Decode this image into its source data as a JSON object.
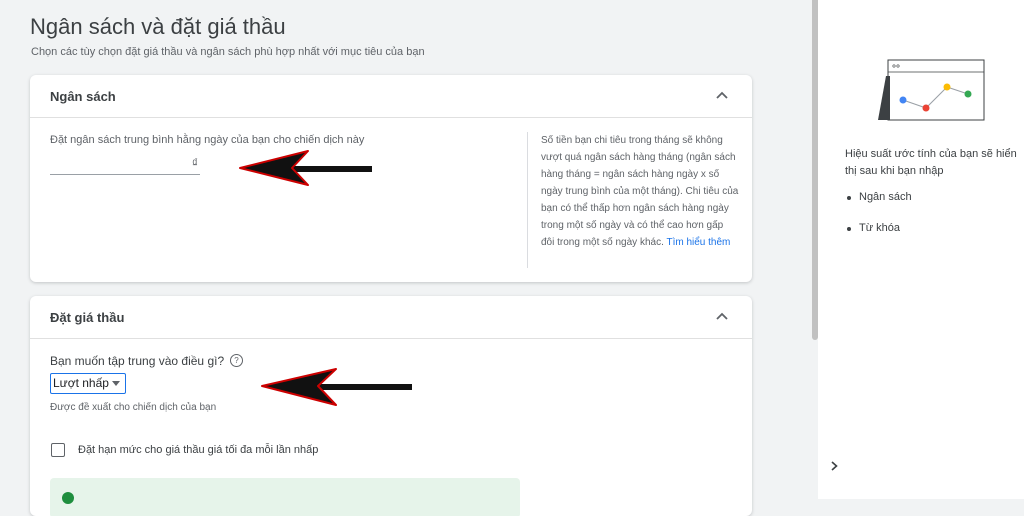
{
  "header": {
    "title": "Ngân sách và đặt giá thầu",
    "subtitle": "Chọn các tùy chọn đặt giá thầu và ngân sách phù hợp nhất với mục tiêu của bạn"
  },
  "budget": {
    "title": "Ngân sách",
    "label": "Đặt ngân sách trung bình hằng ngày của bạn cho chiến dịch này",
    "currency": "₫",
    "help_text": "Số tiền bạn chi tiêu trong tháng sẽ không vượt quá ngân sách hàng tháng (ngân sách hàng tháng = ngân sách hàng ngày x số ngày trung bình của một tháng). Chi tiêu của bạn có thể thấp hơn ngân sách hàng ngày trong một số ngày và có thể cao hơn gấp đôi trong một số ngày khác.",
    "help_link": "Tìm hiểu thêm"
  },
  "bidding": {
    "title": "Đặt giá thầu",
    "question": "Bạn muốn tập trung vào điều gì?",
    "help_glyph": "?",
    "select_value": "Lượt nhấp",
    "note": "Được đề xuất cho chiến dịch của bạn",
    "checkbox_label": "Đặt hạn mức cho giá thầu giá tối đa mỗi lần nhấp"
  },
  "sidebar": {
    "text": "Hiệu suất ước tính của bạn sẽ hiển thị sau khi bạn nhập",
    "items": [
      "Ngân sách",
      "Từ khóa"
    ]
  },
  "colors": {
    "accent": "#1a73e8",
    "arrow": "#111111",
    "arrow_outline": "#cc0000",
    "dot_blue": "#4285f4",
    "dot_red": "#ea4335",
    "dot_yellow": "#fbbc04",
    "dot_green": "#34a853"
  },
  "icons": {
    "collapse": "chevron-up-icon",
    "expand_panel": "chevron-right-icon",
    "help": "help-circle-icon",
    "annotation": "arrow-left-icon"
  }
}
